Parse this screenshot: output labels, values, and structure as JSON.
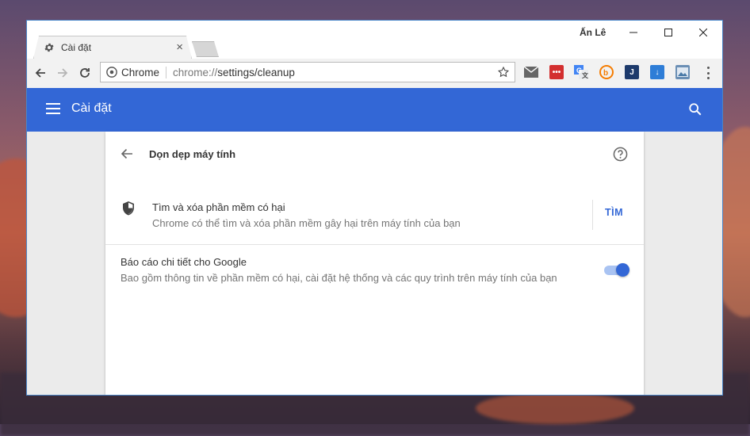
{
  "window": {
    "tab_title": "Cài đặt",
    "user_badge": "Ấn Lê",
    "controls": {
      "minimize": "—",
      "maximize": "☐",
      "close": "✕"
    }
  },
  "toolbar": {
    "secure_label": "Chrome",
    "url_scheme": "chrome://",
    "url_path": "settings/cleanup",
    "extensions": [
      {
        "icon": "mail-icon"
      },
      {
        "icon": "lastpass-icon",
        "label": "•••"
      },
      {
        "icon": "translate-icon"
      },
      {
        "icon": "b-extension-icon"
      },
      {
        "icon": "j-extension-icon",
        "label": "J"
      },
      {
        "icon": "download-icon",
        "label": "↓"
      },
      {
        "icon": "image-extension-icon"
      }
    ]
  },
  "header": {
    "title": "Cài đặt"
  },
  "cleanup": {
    "page_title": "Dọn dẹp máy tính",
    "find_row": {
      "title": "Tìm và xóa phần mềm có hại",
      "description": "Chrome có thể tìm và xóa phần mềm gây hại trên máy tính của bạn",
      "button": "TÌM"
    },
    "report_row": {
      "title": "Báo cáo chi tiết cho Google",
      "description": "Bao gồm thông tin về phần mềm có hại, cài đặt hệ thống và các quy trình trên máy tính của bạn",
      "toggle_on": true
    }
  },
  "colors": {
    "accent": "#3367d6",
    "toggle_track": "#a9c3f2",
    "window_border": "#4a86c8"
  }
}
